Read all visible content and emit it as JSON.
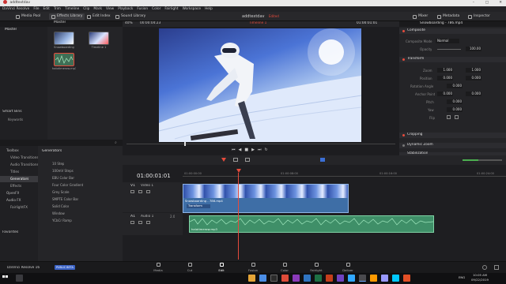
{
  "window": {
    "title": "addtextdav",
    "minimize": "–",
    "maximize": "□",
    "close": "✕"
  },
  "menu": [
    "DaVinci Resolve",
    "File",
    "Edit",
    "Trim",
    "Timeline",
    "Clip",
    "Mark",
    "View",
    "Playback",
    "Fusion",
    "Color",
    "Fairlight",
    "Workspace",
    "Help"
  ],
  "toolbar": {
    "media_pool": "Media Pool",
    "effects_library": "Effects Library",
    "edit_index": "Edit Index",
    "sound_library": "Sound Library",
    "project_title": "addtextdav",
    "edited": "Edited",
    "mixer": "Mixer",
    "metadata": "Metadata",
    "inspector": "Inspector"
  },
  "media_pool": {
    "master": "Master",
    "items": [
      {
        "name": "Snowboarding"
      },
      {
        "name": "Timeline 1"
      },
      {
        "name": "halotimerow.mp3"
      }
    ],
    "smart_bins": "Smart Bins",
    "keywords": "Keywords"
  },
  "viewer": {
    "zoom": "40%",
    "timecode_left": "00:00:04:23",
    "timeline_name": "Timeline 1",
    "timecode_right": "01:00:01:01",
    "clip_title": "Snowboarding - 786.mp4"
  },
  "inspector": {
    "clip_name": "Snowboarding - 786.mp4",
    "composite": "Composite",
    "composite_mode_label": "Composite Mode",
    "composite_mode": "Normal",
    "opacity_label": "Opacity",
    "opacity": "100.00",
    "transform": "Transform",
    "zoom_label": "Zoom",
    "zoom_x": "1.000",
    "zoom_y": "1.000",
    "position_label": "Position",
    "position_x": "0.000",
    "position_y": "0.000",
    "rotation_label": "Rotation Angle",
    "rotation": "0.000",
    "anchor_label": "Anchor Point",
    "anchor_x": "0.000",
    "anchor_y": "0.000",
    "pitch_label": "Pitch",
    "pitch": "0.000",
    "yaw_label": "Yaw",
    "yaw": "0.000",
    "flip_label": "Flip",
    "cropping": "Cropping",
    "dynamic_zoom": "Dynamic Zoom",
    "stabilization": "Stabilization"
  },
  "toolbox": {
    "header": "Toolbox",
    "items": [
      "Video Transitions",
      "Audio Transitions",
      "Titles",
      "Generators",
      "Effects",
      "OpenFX",
      "Audio FX",
      "FairlightFX"
    ],
    "favorites": "Favorites"
  },
  "generators": {
    "header": "Generators",
    "items": [
      "10 Step",
      "100mV Steps",
      "EBU Color Bar",
      "Four Color Gradient",
      "Grey Scale",
      "SMPTE Color Bar",
      "Solid Color",
      "Window",
      "YCbCr Ramp"
    ]
  },
  "timeline": {
    "timecode": "01:00:01:01",
    "ruler": [
      "01:00:00:00",
      "01:00:08:00",
      "01:00:16:00",
      "01:00:24:00",
      "01:00:32:00"
    ],
    "v1": "V1",
    "video1": "Video 1",
    "a1": "A1",
    "audio1": "Audio 1",
    "audio_level": "2.0",
    "video_clip": "Snowboarding - 786.mp4",
    "transform_tag": "Transform",
    "audio_clip": "halotimerow.mp3"
  },
  "bottom_bar": {
    "app": "DaVinci Resolve 16",
    "beta": "PUBLIC BETA",
    "pages": [
      "Media",
      "Cut",
      "Edit",
      "Fusion",
      "Color",
      "Fairlight",
      "Deliver"
    ],
    "active_page": "Edit"
  },
  "taskbar": {
    "lang": "ENG",
    "time": "10:05 AM",
    "date": "09/22/2019"
  },
  "colors": {
    "accent": "#e64b3c",
    "video_clip": "#3e6ea6",
    "audio_clip": "#3f8f68",
    "panel": "#242427"
  }
}
